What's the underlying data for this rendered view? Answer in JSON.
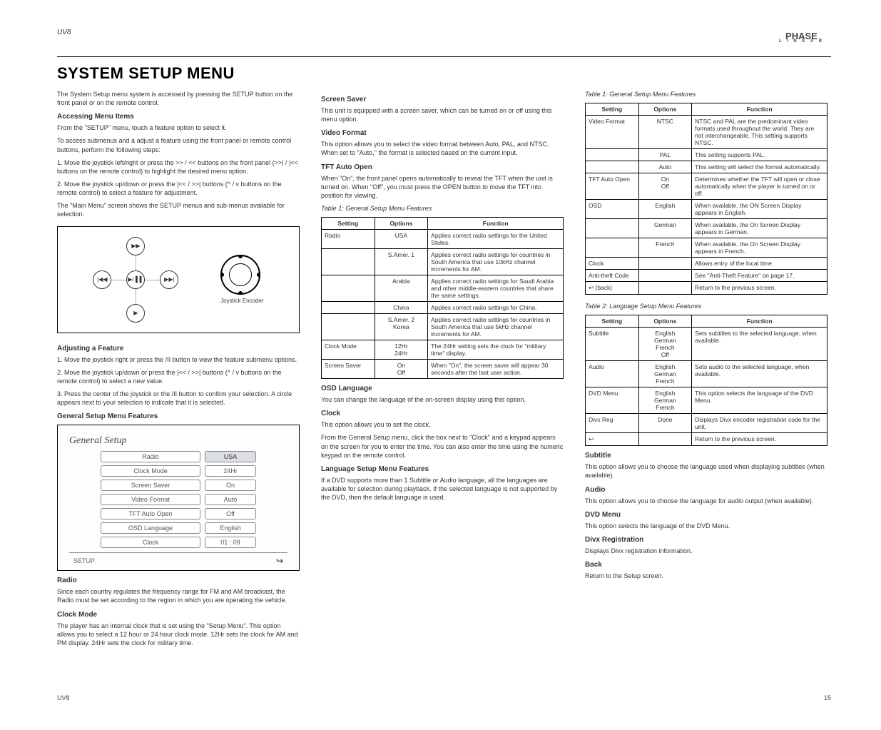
{
  "header": {
    "product": "UV8",
    "brand_top": "PHASE",
    "brand_sub": "L I N E A R",
    "title": "SYSTEM SETUP MENU"
  },
  "col1": {
    "p1": "The System Setup menu system is accessed by pressing the SETUP button on the front panel or on the remote control.",
    "h_access": "Accessing Menu Items",
    "p2": "From the \"SETUP\" menu, touch a feature option to select it.",
    "p3": "To access submenus and a adjust a feature using the front panel or remote control buttons, perform the following steps:",
    "li1": "1. Move the joystick left/right or press the >> / << buttons on the front panel (>>| / |<< buttons on the remote control) to highlight the desired menu option.",
    "li2": "2. Move the joystick up/down or press the |<< / >>| buttons (^ / v buttons on the remote control) to select a feature for adjustment.",
    "p4": "The \"Main Menu\" screen shows the SETUP menus and sub-menus available for selection.",
    "joy_label": "Joystick Encoder",
    "pad_u": "▶▶",
    "pad_d": "▶",
    "pad_l": "|◀◀",
    "pad_r": "▶▶|",
    "pad_m": "▶/ ▌▌",
    "h_adjust": "Adjusting a Feature",
    "adj1": "1. Move the joystick right or press the /II button to view the feature submenu options.",
    "adj2": "2. Move the joystick up/down or press the |<< / >>| buttons (^ / v buttons on the remote control) to select a new value.",
    "adj3": "3. Press the center of the joystick or the /II button to confirm your selection. A circle appears next to your selection to indicate that it is selected.",
    "h_general": "General Setup Menu Features",
    "osd_title": "General Setup",
    "osd": [
      {
        "label": "Radio",
        "val": "USA",
        "sel": true
      },
      {
        "label": "Clock Mode",
        "val": "24Hr"
      },
      {
        "label": "Screen Saver",
        "val": "On"
      },
      {
        "label": "Video Format",
        "val": "Auto"
      },
      {
        "label": "TFT Auto Open",
        "val": "Off"
      },
      {
        "label": "OSD Language",
        "val": "English"
      },
      {
        "label": "Clock",
        "val": "01 : 09"
      }
    ],
    "osd_foot_left": "SETUP",
    "h_radio": "Radio",
    "p_radio": "Since each country regulates the frequency range for FM and AM broadcast, the Radio must be set according to the region in which you are operating the vehicle.",
    "h_clock": "Clock Mode",
    "p_clock": "The player has an internal clock that is set using the \"Setup Menu\". This option allows you to select a 12 hour or 24 hour clock mode. 12Hr sets the clock for AM and PM display. 24Hr sets the clock for military time."
  },
  "col2": {
    "h_ss": "Screen Saver",
    "p_ss": "This unit is equipped with a screen saver, which can be turned on or off using this menu option.",
    "h_vf": "Video Format",
    "p_vf": "This option allows you to select the video format between Auto, PAL, and NTSC. When set to \"Auto,\" the format is selected based on the current input.",
    "h_tft": "TFT Auto Open",
    "p_tft": "When \"On\", the front panel opens automatically to reveal the TFT when the unit is turned on. When \"Off\", you must press the OPEN button to move the TFT into position for viewing.",
    "table1_h1": "Setting",
    "table1_h2": "Options",
    "table1_h3": "Function",
    "t1": [
      {
        "s": "Radio",
        "o": "USA",
        "f": "Applies correct radio settings for the United States."
      },
      {
        "s": "",
        "o": "S.Amer. 1",
        "f": "Applies correct radio settings for countries in South America that use 10kHz channel increments for AM."
      },
      {
        "s": "",
        "o": "Arabia",
        "f": "Applies correct radio settings for Saudi Arabia and other middle-eastern countries that share the same settings."
      },
      {
        "s": "",
        "o": "China",
        "f": "Applies correct radio settings for China."
      },
      {
        "s": "",
        "o": "S.Amer. 2\nKorea",
        "f": "Applies correct radio settings for countries in South America that use 5kHz channel increments for AM."
      },
      {
        "s": "Clock Mode",
        "o": "12Hr\n24Hr",
        "f": "The 24Hr setting sets the clock for \"military time\" display."
      },
      {
        "s": "Screen Saver",
        "o": "On\nOff",
        "f": "When \"On\", the screen saver will appear 30 seconds after the last user action."
      }
    ],
    "h_osd": "OSD Language",
    "p_osd": "You can change the language of the on-screen display using this option.",
    "h_clock2": "Clock",
    "p_clock2a": "This option allows you to set the clock.",
    "p_clock2b": "From the General Setup menu, click the box next to \"Clock\" and a keypad appears on the screen for you to enter the time. You can also enter the time using the numeric keypad on the remote control.",
    "h_lang": "Language Setup Menu Features",
    "p_lang": "If a DVD supports more than 1 Subtitle or Audio language, all the languages are available for selection during playback. If the selected language is not supported by the DVD, then the default language is used."
  },
  "col3": {
    "table2_h1": "Setting",
    "table2_h2": "Options",
    "table2_h3": "Function",
    "t2": [
      {
        "s": "Video Format",
        "o": "NTSC",
        "f": "NTSC and PAL are the predominant video formats used throughout the world. They are not interchangeable. This setting supports NTSC."
      },
      {
        "s": "",
        "o": "PAL",
        "f": "This setting supports PAL."
      },
      {
        "s": "",
        "o": "Auto",
        "f": "This setting will select the format automatically."
      },
      {
        "s": "TFT Auto Open",
        "o": "On\nOff",
        "f": "Determines whether the TFT will open or close automatically when the player is turned on or off."
      },
      {
        "s": "OSD",
        "o": "English",
        "f": "When available, the ON Screen Display appears in English."
      },
      {
        "s": "",
        "o": "German",
        "f": "When available, the On Screen Display appears in German."
      },
      {
        "s": "",
        "o": "French",
        "f": "When available, the On Screen Display appears in French."
      },
      {
        "s": "Clock",
        "o": "",
        "f": "Allows entry of the local time."
      },
      {
        "s": "Anti-theft Code",
        "o": "",
        "f": "See \"Anti-Theft Feature\" on page 17."
      },
      {
        "s": "↩ (back)",
        "o": "",
        "f": "Return to the previous screen."
      }
    ],
    "table3_h1": "Setting",
    "table3_h2": "Options",
    "table3_h3": "Function",
    "t3": [
      {
        "s": "Subtitle",
        "o": "English\nGerman\nFrench\nOff",
        "f": "Sets subtitles to the selected language, when available."
      },
      {
        "s": "Audio",
        "o": "English\nGerman\nFrench",
        "f": "Sets audio to the selected language, when available."
      },
      {
        "s": "DVD Menu",
        "o": "English\nGerman\nFrench",
        "f": "This option selects the language of the DVD Menu."
      },
      {
        "s": "Divx Reg",
        "o": "Done",
        "f": "Displays Divx encoder registration code for the unit."
      },
      {
        "s": "↩",
        "o": "",
        "f": "Return to the previous screen."
      }
    ],
    "h_sub": "Subtitle",
    "p_sub": "This option allows you to choose the language used when displaying subtitles (when available).",
    "h_audio": "Audio",
    "p_audio": "This option allows you to choose the language for audio output (when available).",
    "h_dvd": "DVD Menu",
    "p_dvd": "This option selects the language of the DVD Menu.",
    "h_divx": "Divx Registration",
    "p_divx": "Displays Divx registration information.",
    "h_back": "Back",
    "p_back": "Return to the Setup screen."
  },
  "footer": {
    "left": "UV8",
    "right": "15"
  }
}
